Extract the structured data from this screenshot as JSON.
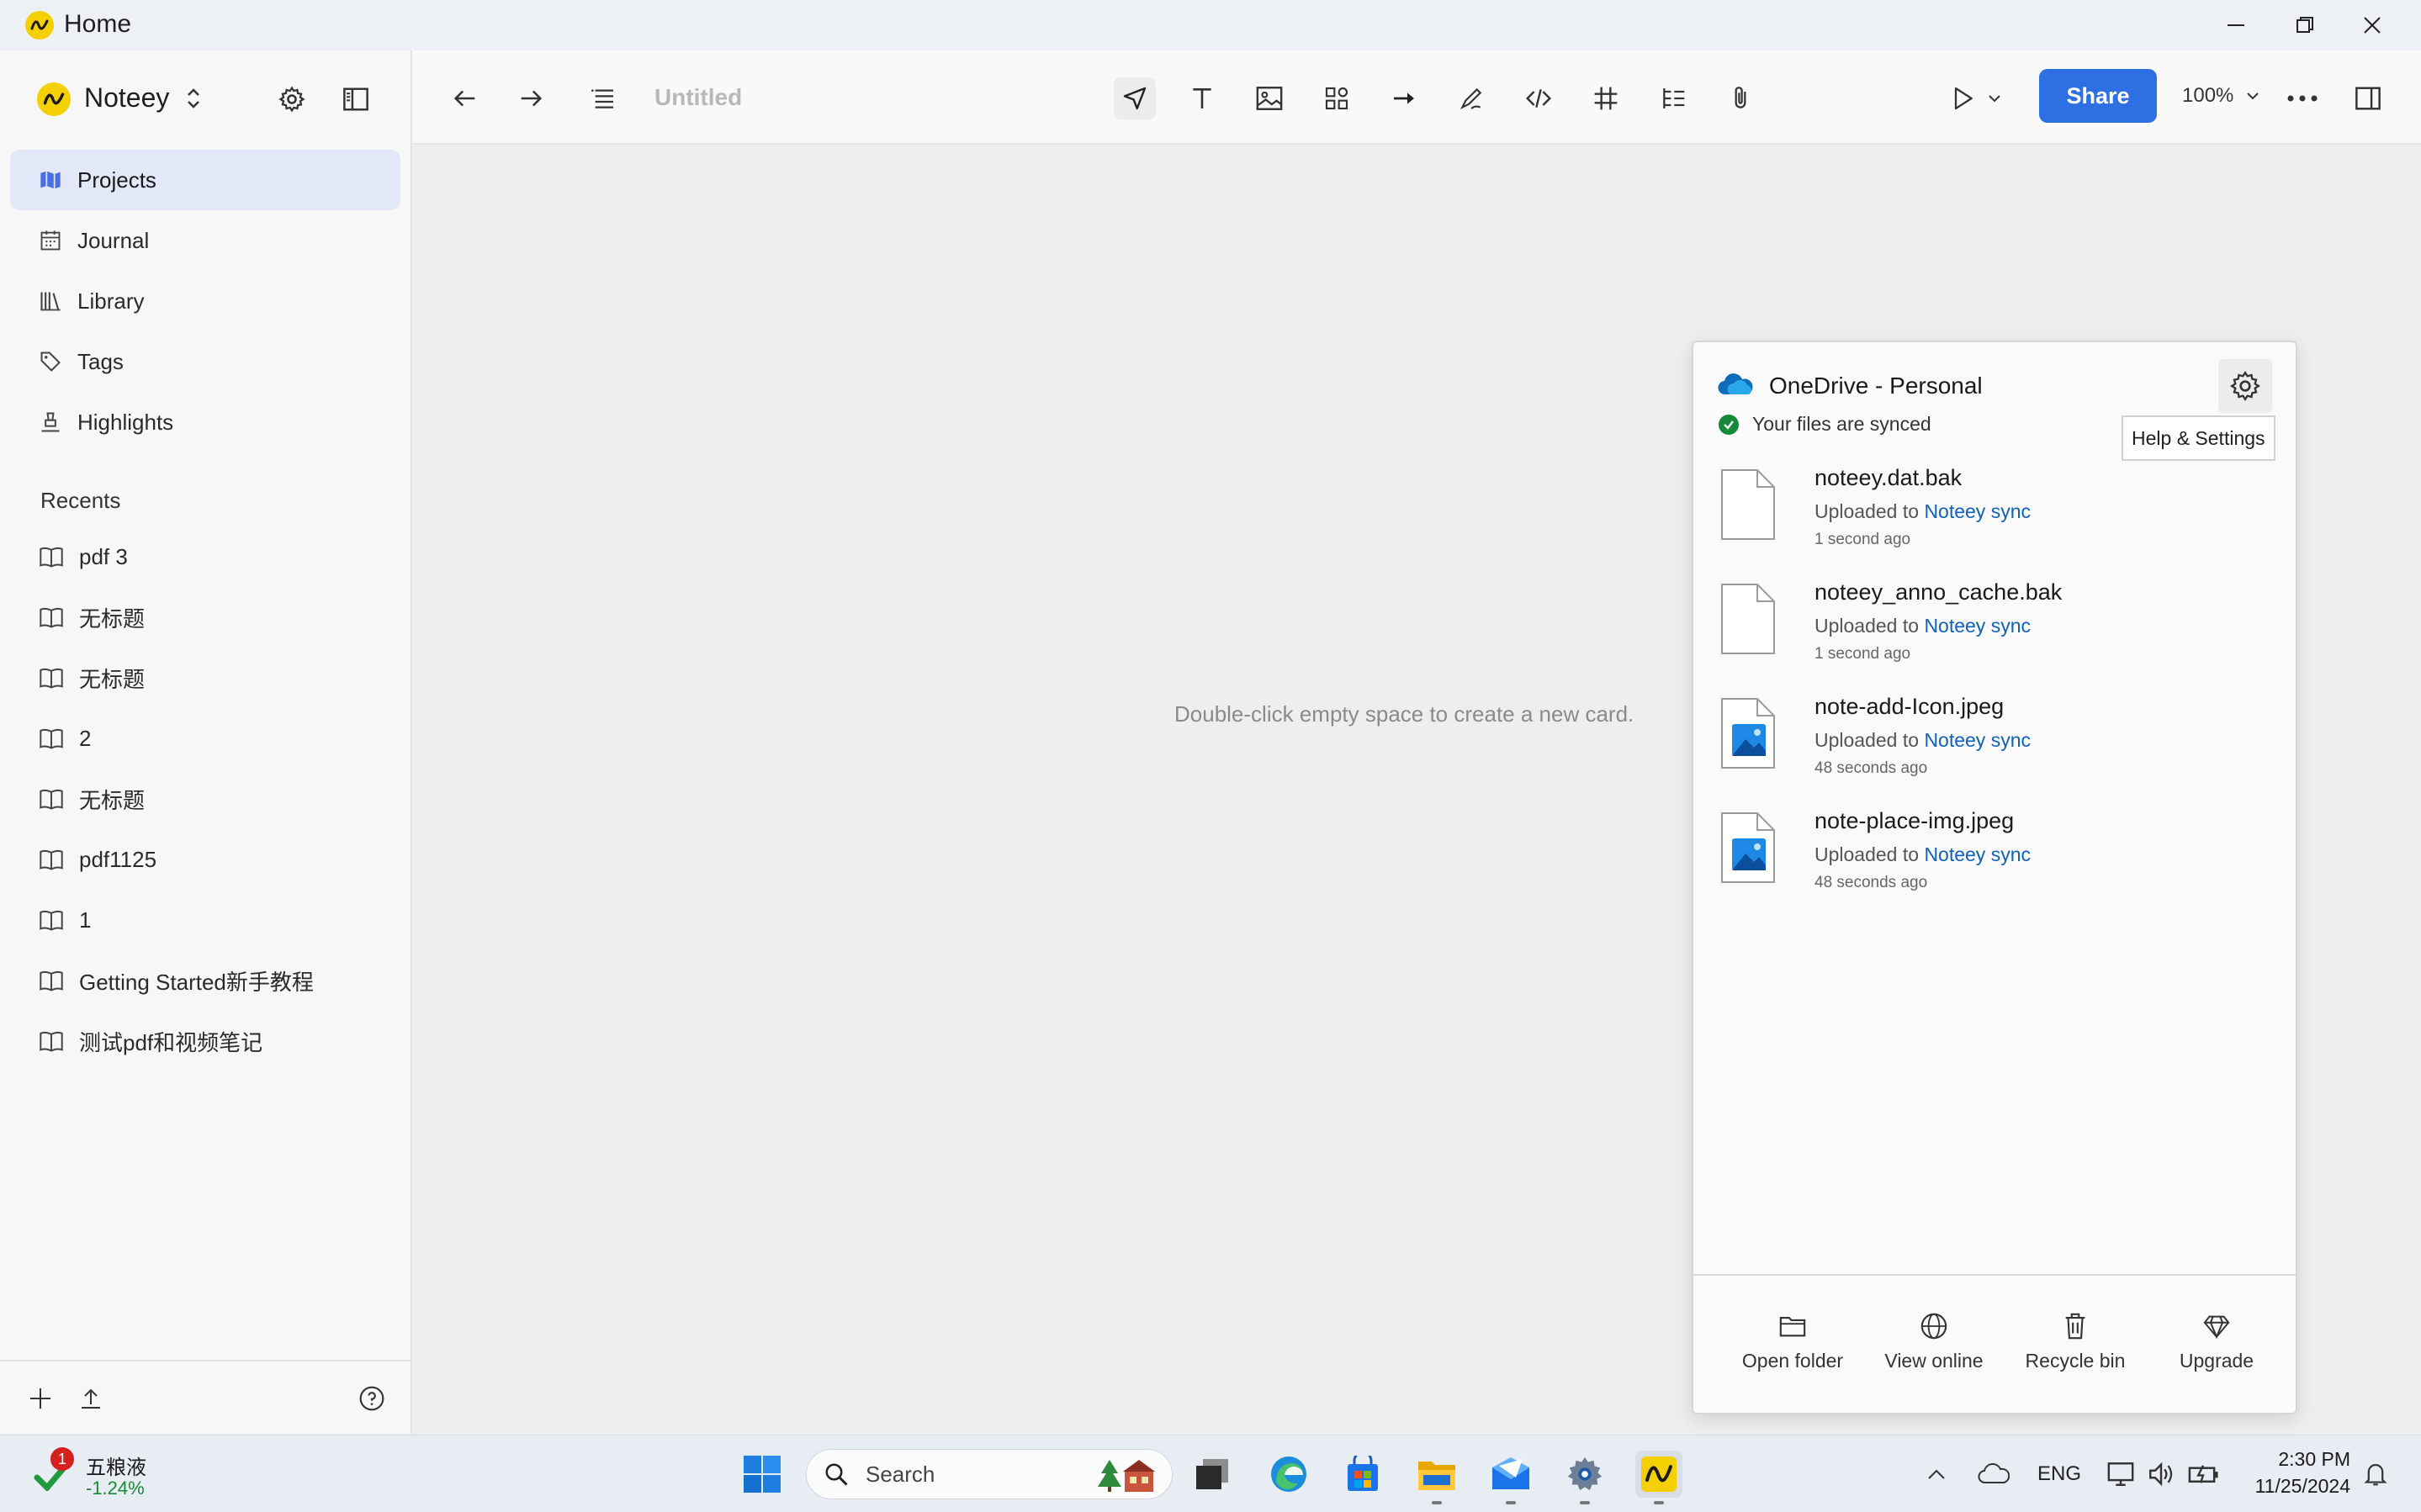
{
  "window": {
    "title": "Home"
  },
  "sidebar": {
    "app_name": "Noteey",
    "nav": [
      {
        "label": "Projects",
        "icon": "map-icon",
        "active": true
      },
      {
        "label": "Journal",
        "icon": "calendar-icon"
      },
      {
        "label": "Library",
        "icon": "library-icon"
      },
      {
        "label": "Tags",
        "icon": "tag-icon"
      },
      {
        "label": "Highlights",
        "icon": "highlighter-icon"
      }
    ],
    "recents_title": "Recents",
    "recents": [
      {
        "label": "pdf 3"
      },
      {
        "label": "无标题"
      },
      {
        "label": "无标题"
      },
      {
        "label": "2"
      },
      {
        "label": "无标题"
      },
      {
        "label": "pdf1125"
      },
      {
        "label": "1"
      },
      {
        "label": "Getting Started新手教程"
      },
      {
        "label": "测试pdf和视频笔记"
      }
    ]
  },
  "toolbar": {
    "doc_title": "Untitled",
    "share_label": "Share",
    "zoom": "100%"
  },
  "canvas": {
    "hint": "Double-click empty space to create a new card."
  },
  "onedrive": {
    "title": "OneDrive - Personal",
    "status": "Your files are synced",
    "tooltip": "Help & Settings",
    "files": [
      {
        "name": "noteey.dat.bak",
        "action": "Uploaded to",
        "folder": "Noteey sync",
        "time": "1 second ago",
        "type": "file"
      },
      {
        "name": "noteey_anno_cache.bak",
        "action": "Uploaded to",
        "folder": "Noteey sync",
        "time": "1 second ago",
        "type": "file"
      },
      {
        "name": "note-add-Icon.jpeg",
        "action": "Uploaded to",
        "folder": "Noteey sync",
        "time": "48 seconds ago",
        "type": "image"
      },
      {
        "name": "note-place-img.jpeg",
        "action": "Uploaded to",
        "folder": "Noteey sync",
        "time": "48 seconds ago",
        "type": "image"
      }
    ],
    "actions": [
      {
        "label": "Open folder"
      },
      {
        "label": "View online"
      },
      {
        "label": "Recycle bin"
      },
      {
        "label": "Upgrade"
      }
    ]
  },
  "taskbar": {
    "stock_badge": "1",
    "stock_name": "五粮液",
    "stock_change": "-1.24%",
    "search_placeholder": "Search",
    "lang": "ENG",
    "time": "2:30 PM",
    "date": "11/25/2024"
  },
  "colors": {
    "accent": "#2f6fe4",
    "brand": "#f5d000",
    "link": "#1060c0",
    "synced": "#138a3a"
  }
}
